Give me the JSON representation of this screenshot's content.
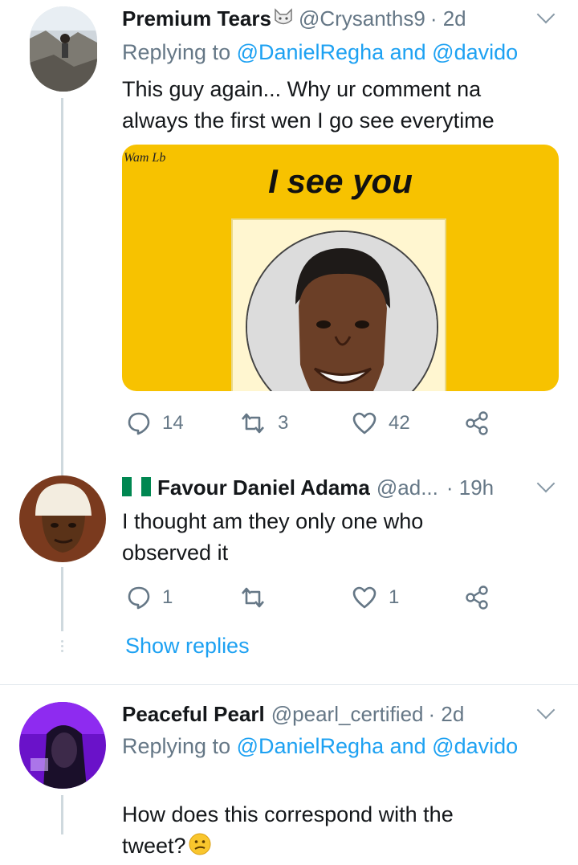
{
  "tweets": [
    {
      "name": "Premium Tears",
      "handle": "@Crysanths9",
      "time": "· 2d",
      "reply_prefix": "Replying to ",
      "reply_users": "@DanielRegha and @davido",
      "text": "This guy again... Why ur comment na\nalways the first wen I go see everytime",
      "card": {
        "watermark": "Wam Lb",
        "caption": "I see you"
      },
      "stats": {
        "replies": "14",
        "retweets": "3",
        "likes": "42"
      }
    },
    {
      "name": "Favour Daniel Adama",
      "handle": "@ad...",
      "time": "· 19h",
      "text": "I thought am they only one who\nobserved it",
      "stats": {
        "replies": "1",
        "retweets": "",
        "likes": "1"
      }
    },
    {
      "name": "Peaceful Pearl",
      "handle": "@pearl_certified",
      "time": "· 2d",
      "reply_prefix": "Replying to ",
      "reply_users": "@DanielRegha and @davido",
      "text": "How does this correspond with the\ntweet?"
    }
  ],
  "show_replies": "Show replies",
  "colors": {
    "link": "#1da1f2",
    "muted": "#657786",
    "card_bg": "#f7c200"
  },
  "icons": [
    "reply-icon",
    "retweet-icon",
    "like-icon",
    "share-icon",
    "chevron-down-icon",
    "nigeria-flag-icon",
    "cat-emoji-icon",
    "confused-emoji-icon"
  ]
}
